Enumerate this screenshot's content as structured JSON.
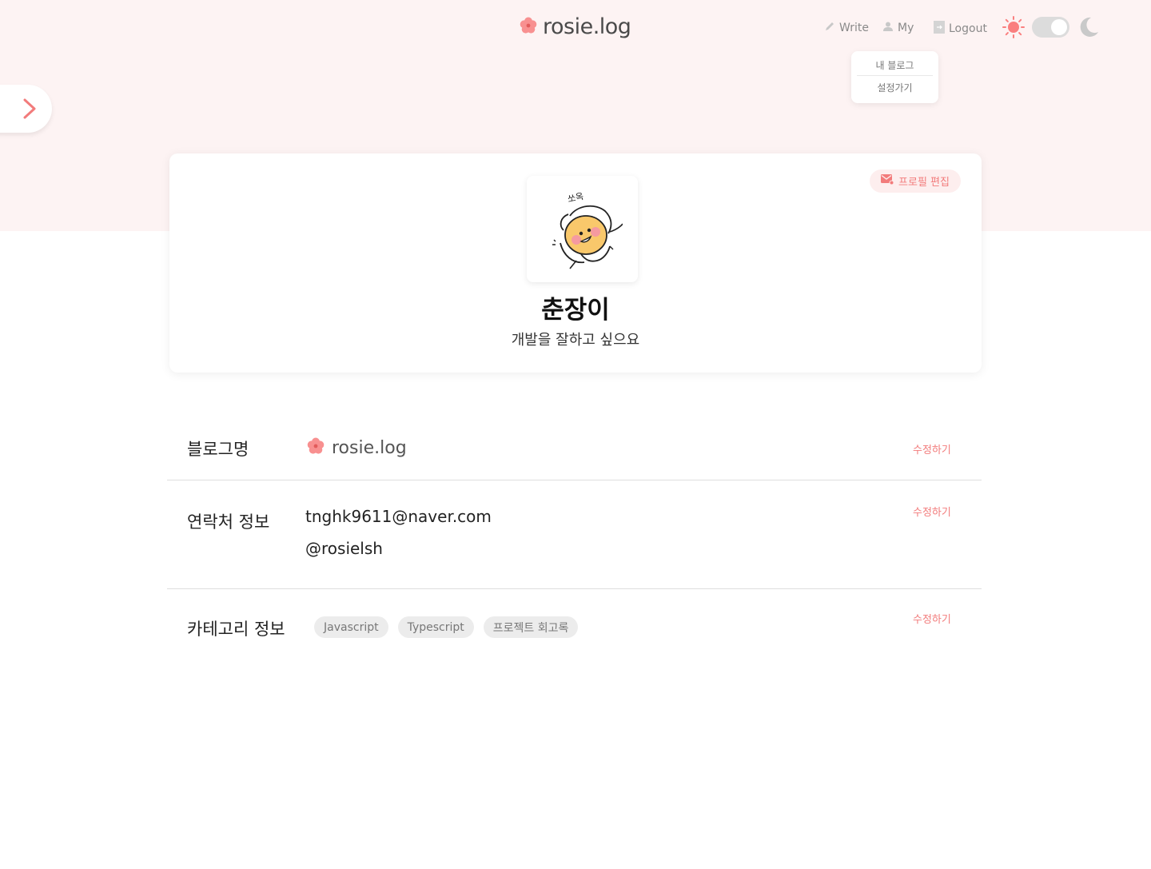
{
  "header": {
    "logo_text": "rosie.log",
    "logo_icon": "flower-icon",
    "nav": {
      "write": "Write",
      "my": "My",
      "logout": "Logout"
    }
  },
  "dropdown": {
    "items": [
      "내 블로그",
      "설정가기"
    ]
  },
  "profile": {
    "edit_label": "프로필 편집",
    "nickname": "춘장이",
    "bio": "개발을 잘하고 싶으요",
    "avatar_caption": "쏘옥"
  },
  "settings": {
    "blog_name": {
      "label": "블로그명",
      "value": "rosie.log",
      "edit": "수정하기"
    },
    "contact": {
      "label": "연락처 정보",
      "email": "tnghk9611@naver.com",
      "handle": "@rosielsh",
      "edit": "수정하기"
    },
    "category": {
      "label": "카테고리 정보",
      "tags": [
        "Javascript",
        "Typescript",
        "프로젝트 회고록"
      ],
      "edit": "수정하기"
    }
  },
  "colors": {
    "accent": "#f27b7b",
    "hero_bg": "#fdf3f3",
    "sun": "#fa7f7f"
  }
}
